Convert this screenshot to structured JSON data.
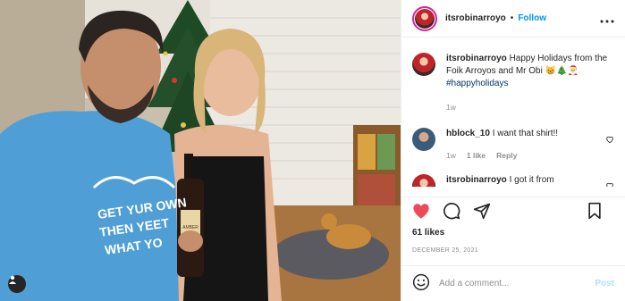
{
  "post": {
    "author": "itsrobinarroyo",
    "dot": "•",
    "follow_label": "Follow",
    "more_icon": "more-icon",
    "caption": {
      "username": "itsrobinarroyo",
      "text": "Happy Holidays from the Foik Arroyos and Mr Obi 😸🎄🎅",
      "hashtag": "#happyholidays",
      "age": "1w"
    },
    "comments": [
      {
        "username": "hblock_10",
        "text": "I want that shirt!!",
        "age": "1w",
        "likes": "1 like",
        "reply": "Reply"
      },
      {
        "username": "itsrobinarroyo",
        "text": "I got it from",
        "age": "",
        "likes": "",
        "reply": ""
      }
    ],
    "likes": "61 likes",
    "date": "DECEMBER 25, 2021",
    "add_comment_placeholder": "Add a comment...",
    "post_label": "Post",
    "shirt_text": [
      "GET YUR OWN",
      "THEN YEET",
      "WHAT YO"
    ],
    "bottle_label": "AMBER"
  },
  "colors": {
    "accent": "#0095f6",
    "like_red": "#ed4956",
    "muted": "#8e8e8e",
    "post_disabled": "#b2dffc"
  }
}
